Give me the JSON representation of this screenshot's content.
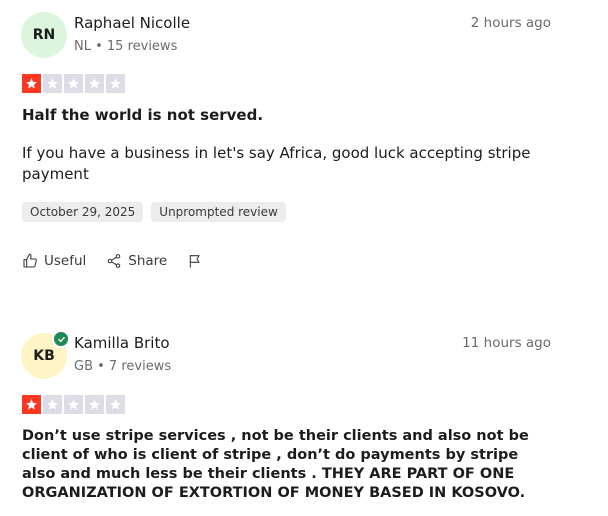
{
  "reviews": [
    {
      "initials": "RN",
      "avatar_color": "#dcf5dd",
      "name": "Raphael Nicolle",
      "meta": "NL • 15 reviews",
      "time": "2 hours ago",
      "rating": 1,
      "title": "Half the world is not served.",
      "body": "If you have a business in let's say Africa, good luck accepting stripe payment",
      "date_tag": "October 29, 2025",
      "type_tag": "Unprompted review",
      "useful_label": "Useful",
      "share_label": "Share"
    },
    {
      "initials": "KB",
      "avatar_color": "#fef4c5",
      "verified": true,
      "name": "Kamilla Brito",
      "meta": "GB • 7 reviews",
      "time": "11 hours ago",
      "rating": 1,
      "body": "Don’t use stripe services , not be their clients and also not be client of who is client of stripe , don’t do payments by stripe also and much less be their clients . THEY ARE PART OF ONE ORGANIZATION OF EXTORTION OF MONEY BASED IN KOSOVO."
    }
  ],
  "colors": {
    "star_filled": "#ff3722",
    "star_empty": "#dcdce6",
    "verified": "#1e8a56"
  }
}
